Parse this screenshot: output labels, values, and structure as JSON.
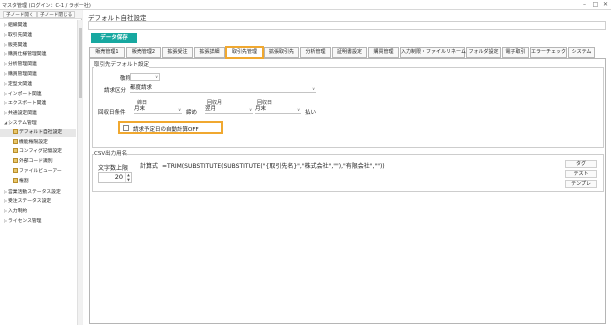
{
  "window": {
    "title": "マスタ管理 (ログイン：C-1 / ラボー社)"
  },
  "toolbar": {
    "expand_label": "子ノード開く",
    "collapse_label": "子ノード閉じる"
  },
  "tree": [
    {
      "label": "組織関連",
      "arrow": "▷"
    },
    {
      "label": "取引先関連",
      "arrow": "▷"
    },
    {
      "label": "販売関連",
      "arrow": "▷"
    },
    {
      "label": "購買仕様管理関連",
      "arrow": "▷"
    },
    {
      "label": "分析管理関連",
      "arrow": "▷"
    },
    {
      "label": "購買管理関連",
      "arrow": "▷"
    },
    {
      "label": "定型文関連",
      "arrow": "▷"
    },
    {
      "label": "インポート関連",
      "arrow": "▷"
    },
    {
      "label": "エクスポート関連",
      "arrow": "▷"
    },
    {
      "label": "共通設定関連",
      "arrow": "▷"
    },
    {
      "label": "システム管理",
      "arrow": "◢"
    },
    {
      "label": "デフォルト自社設定",
      "leaf": true,
      "selected": true
    },
    {
      "label": "機能権限設定",
      "leaf": true
    },
    {
      "label": "コンフィグ記憶設定",
      "leaf": true
    },
    {
      "label": "外部コード識別",
      "leaf": true
    },
    {
      "label": "ファイルビューアー",
      "leaf": true
    },
    {
      "label": "権割",
      "leaf": true
    },
    {
      "label": "営業活動ステータス設定",
      "arrow": "▷"
    },
    {
      "label": "受注ステータス設定",
      "arrow": "▷"
    },
    {
      "label": "入力制約",
      "arrow": "▷"
    },
    {
      "label": "ライセンス管理",
      "arrow": "▷"
    }
  ],
  "main": {
    "title": "デフォルト自社設定",
    "title_value": "",
    "save_label": "データ保存"
  },
  "tabs": [
    {
      "label": "販売管理1"
    },
    {
      "label": "販売管理2"
    },
    {
      "label": "拡張受注"
    },
    {
      "label": "拡張詳細"
    },
    {
      "label": "取引先管理",
      "active": true,
      "highlighted": true
    },
    {
      "label": "拡張取引先"
    },
    {
      "label": "分析管理"
    },
    {
      "label": "証明書設定"
    },
    {
      "label": "購買管理"
    },
    {
      "label": "入力制限・ファイルリネーム"
    },
    {
      "label": "フォルダ設定"
    },
    {
      "label": "電子取引"
    },
    {
      "label": "エラーチェック"
    },
    {
      "label": "システム"
    }
  ],
  "customer_defaults": {
    "legend": "取引先デフォルト設定",
    "honorific_label": "敬称",
    "honorific_value": "",
    "billing_label": "請求区分",
    "billing_value": "都度請求",
    "collection_label": "回収日条件",
    "closing_day_header": "締日",
    "closing_day_value": "月末",
    "closing_suffix": "締め",
    "collection_month_header": "回収月",
    "collection_month_value": "翌月",
    "collection_day_header": "回収日",
    "collection_day_value": "月末",
    "payment_suffix": "払い",
    "auto_calc_label": "請求予定日の自動計算OFF",
    "auto_calc_checked": false
  },
  "csv_output": {
    "legend": "CSV出力用名",
    "char_limit_label": "文字数上限",
    "char_limit_value": "20",
    "formula_label": "計算式",
    "formula_value": "=TRIM(SUBSTITUTE(SUBSTITUTE(\"{取引先名}\",\"株式会社\",\"\"),\"有限会社\",\"\"))",
    "tag_label": "タグ",
    "test_label": "テスト",
    "template_label": "テンプレ"
  }
}
